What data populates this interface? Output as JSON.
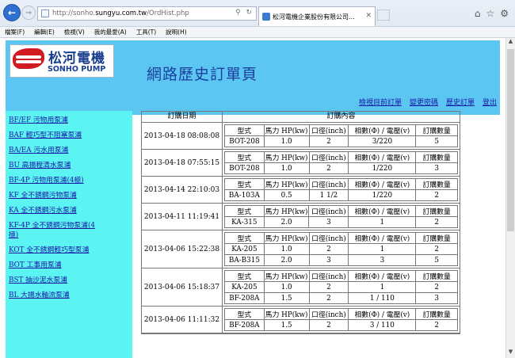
{
  "browser": {
    "address_url_prefix": "http://sonho.",
    "address_url_domain": "sungyu.com.tw",
    "address_url_path": "/OrdHist.php",
    "tab_title": "松河電機企業股份有限公司...",
    "menu": [
      "檔案(F)",
      "編輯(E)",
      "檢視(V)",
      "我的最愛(A)",
      "工具(T)",
      "說明(H)"
    ]
  },
  "header": {
    "logo_cn": "松河電機",
    "logo_en": "SONHO PUMP",
    "title": "網路歷史訂單頁",
    "links": [
      "檢視目前訂單",
      "變更密碼",
      "歷史訂單",
      "登出"
    ]
  },
  "sidebar": {
    "items": [
      "BF/EF 污物用泵浦",
      "BAF 輕巧型不阻塞泵浦",
      "BA/EA 污水用泵浦",
      "BU 高揚程清水泵浦",
      "BF-4P 污物用泵浦(4極)",
      "KF 全不銹鋼污物泵浦",
      "KA 全不銹鋼污水泵浦",
      "KF-4P 全不銹鋼污物泵浦(4極)",
      "KOT 全不銹鋼輕巧型泵浦",
      "BOT 工事用泵浦",
      "BST 抽沙泥水泵浦",
      "BL 大揚水軸流泵浦"
    ]
  },
  "orders": {
    "col_date": "訂購日期",
    "col_content": "訂購內容",
    "item_headers": [
      "型式",
      "馬力 HP(kw)",
      "口徑(inch)",
      "相數(Φ) / 電壓(v)",
      "訂購數量"
    ],
    "rows": [
      {
        "date": "2013-04-18 08:08:08",
        "items": [
          [
            "BOT-208",
            "1.0",
            "2",
            "3/220",
            "5"
          ]
        ]
      },
      {
        "date": "2013-04-18 07:55:15",
        "items": [
          [
            "BOT-208",
            "1.0",
            "2",
            "1/220",
            "3"
          ]
        ]
      },
      {
        "date": "2013-04-14 22:10:03",
        "items": [
          [
            "BA-103A",
            "0.5",
            "1 1/2",
            "1/220",
            "2"
          ]
        ]
      },
      {
        "date": "2013-04-11 11:19:41",
        "items": [
          [
            "KA-315",
            "2.0",
            "3",
            "1",
            "2"
          ]
        ]
      },
      {
        "date": "2013-04-06 15:22:38",
        "items": [
          [
            "KA-205",
            "1.0",
            "2",
            "1",
            "2"
          ],
          [
            "BA-B315",
            "2.0",
            "3",
            "3",
            "5"
          ]
        ]
      },
      {
        "date": "2013-04-06 15:18:37",
        "items": [
          [
            "KA-205",
            "1.0",
            "2",
            "1",
            "2"
          ],
          [
            "BF-208A",
            "1.5",
            "2",
            "1 / 110",
            "3"
          ]
        ]
      },
      {
        "date": "2013-04-06 11:11:32",
        "items": [
          [
            "BF-208A",
            "1.5",
            "2",
            "3 / 110",
            "2"
          ]
        ]
      }
    ]
  }
}
